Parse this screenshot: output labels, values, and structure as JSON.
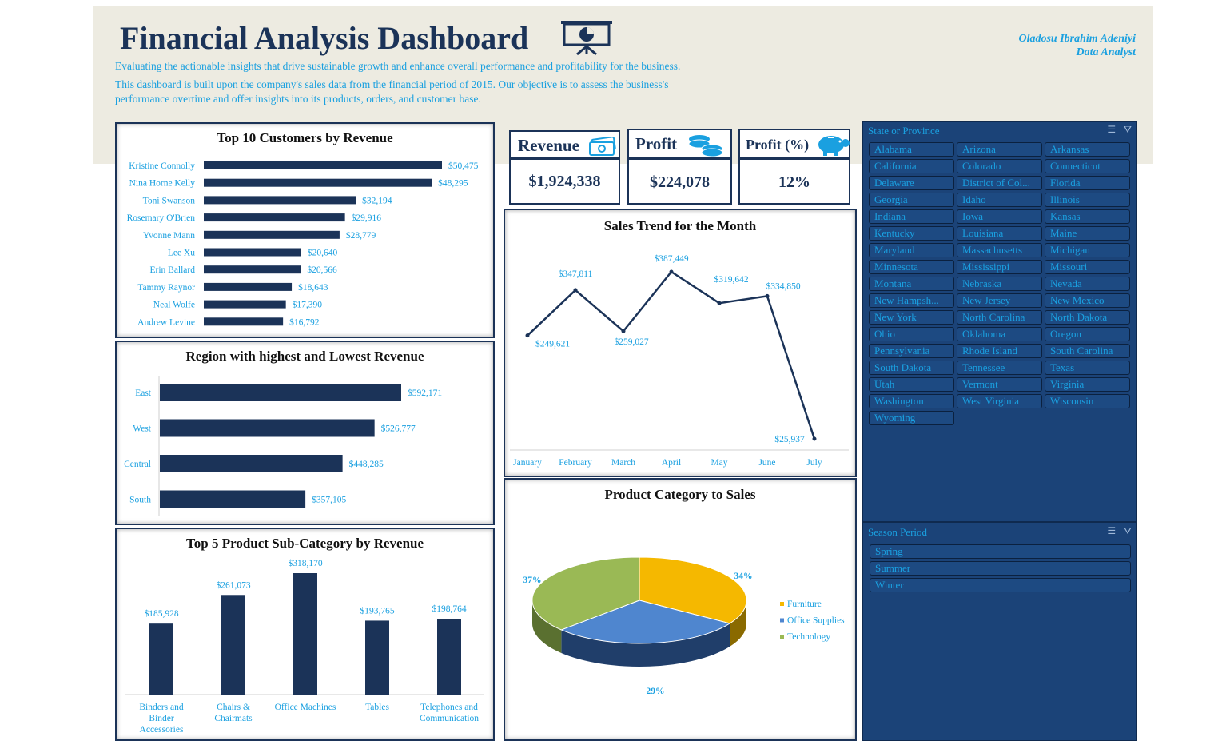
{
  "header": {
    "title": "Financial Analysis Dashboard",
    "intro_line1": "Evaluating the actionable insights that drive sustainable growth and enhance overall performance and profitability for the business.",
    "intro_line2": "This dashboard is built upon the company's sales data from the financial period of 2015. Our objective is to assess the business's performance overtime and offer insights into its products, orders, and customer base.",
    "author_name": "Oladosu Ibrahim Adeniyi",
    "author_role": "Data Analyst"
  },
  "kpis": [
    {
      "label": "Revenue",
      "value": "$1,924,338",
      "icon": "cash-icon"
    },
    {
      "label": "Profit",
      "value": "$224,078",
      "icon": "coins-icon"
    },
    {
      "label": "Profit (%)",
      "value": "12%",
      "icon": "piggy-bank-icon"
    }
  ],
  "colors": {
    "navy": "#1b3358",
    "accent": "#1aa0e0",
    "furniture": "#f5b800",
    "office_supplies": "#4f86cf",
    "technology": "#9ab955"
  },
  "chart_data": [
    {
      "type": "bar",
      "orientation": "horizontal",
      "title": "Top 10 Customers by Revenue",
      "categories": [
        "Kristine Connolly",
        "Nina Horne Kelly",
        "Toni Swanson",
        "Rosemary O'Brien",
        "Yvonne Mann",
        "Lee Xu",
        "Erin Ballard",
        "Tammy Raynor",
        "Neal Wolfe",
        "Andrew Levine"
      ],
      "values": [
        50475,
        48295,
        32194,
        29916,
        28779,
        20640,
        20566,
        18643,
        17390,
        16792
      ],
      "labels": [
        "$50,475",
        "$48,295",
        "$32,194",
        "$29,916",
        "$28,779",
        "$20,640",
        "$20,566",
        "$18,643",
        "$17,390",
        "$16,792"
      ]
    },
    {
      "type": "bar",
      "orientation": "horizontal",
      "title": "Region with highest and Lowest Revenue",
      "categories": [
        "East",
        "West",
        "Central",
        "South"
      ],
      "values": [
        592171,
        526777,
        448285,
        357105
      ],
      "labels": [
        "$592,171",
        "$526,777",
        "$448,285",
        "$357,105"
      ]
    },
    {
      "type": "bar",
      "orientation": "vertical",
      "title": "Top 5 Product Sub-Category by Revenue",
      "categories": [
        "Binders and Binder Accessories",
        "Chairs & Chairmats",
        "Office Machines",
        "Tables",
        "Telephones and Communication"
      ],
      "values": [
        185928,
        261073,
        318170,
        193765,
        198764
      ],
      "labels": [
        "$185,928",
        "$261,073",
        "$318,170",
        "$193,765",
        "$198,764"
      ]
    },
    {
      "type": "line",
      "title": "Sales Trend for the Month",
      "categories": [
        "January",
        "February",
        "March",
        "April",
        "May",
        "June",
        "July"
      ],
      "values": [
        249621,
        347811,
        259027,
        387449,
        319642,
        334850,
        25937
      ],
      "labels": [
        "$249,621",
        "$347,811",
        "$259,027",
        "$387,449",
        "$319,642",
        "$334,850",
        "$25,937"
      ]
    },
    {
      "type": "pie",
      "title": "Product Category to Sales",
      "categories": [
        "Furniture",
        "Office Supplies",
        "Technology"
      ],
      "values": [
        34,
        29,
        37
      ],
      "labels": [
        "34%",
        "29%",
        "37%"
      ],
      "legend": "right"
    }
  ],
  "state_slicer": {
    "title": "State or Province",
    "items": [
      "Alabama",
      "Arizona",
      "Arkansas",
      "California",
      "Colorado",
      "Connecticut",
      "Delaware",
      "District of Col...",
      "Florida",
      "Georgia",
      "Idaho",
      "Illinois",
      "Indiana",
      "Iowa",
      "Kansas",
      "Kentucky",
      "Louisiana",
      "Maine",
      "Maryland",
      "Massachusetts",
      "Michigan",
      "Minnesota",
      "Mississippi",
      "Missouri",
      "Montana",
      "Nebraska",
      "Nevada",
      "New Hampsh...",
      "New Jersey",
      "New Mexico",
      "New York",
      "North Carolina",
      "North Dakota",
      "Ohio",
      "Oklahoma",
      "Oregon",
      "Pennsylvania",
      "Rhode Island",
      "South Carolina",
      "South Dakota",
      "Tennessee",
      "Texas",
      "Utah",
      "Vermont",
      "Virginia",
      "Washington",
      "West Virginia",
      "Wisconsin",
      "Wyoming"
    ]
  },
  "season_slicer": {
    "title": "Season Period",
    "items": [
      "Spring",
      "Summer",
      "Winter"
    ]
  }
}
